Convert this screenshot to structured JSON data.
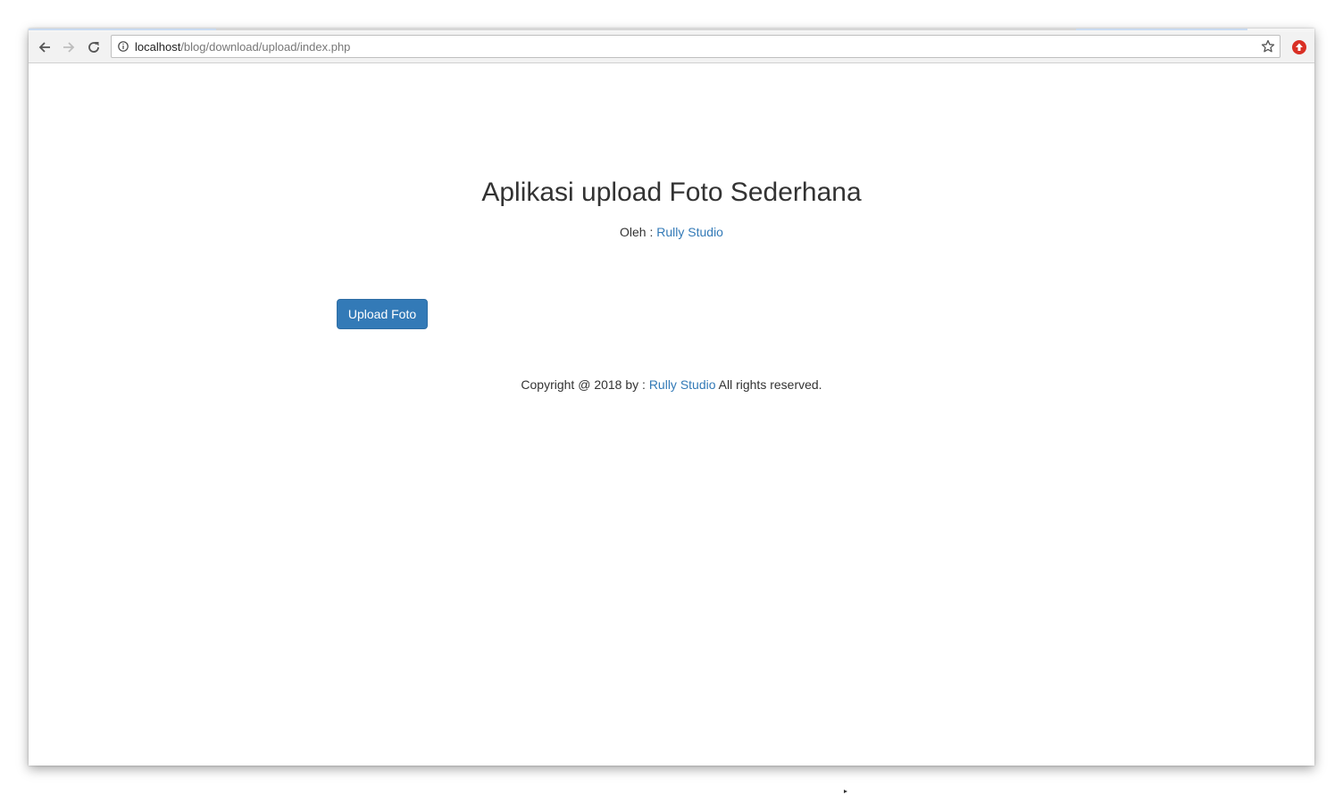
{
  "browser": {
    "url_host": "localhost",
    "url_path": "/blog/download/upload/index.php",
    "icons": {
      "back": "arrow-left-icon",
      "forward": "arrow-right-icon",
      "reload": "reload-icon",
      "info": "info-icon",
      "bookmark": "star-icon",
      "extension": "extension-icon"
    },
    "extension_color": "#d93025"
  },
  "page": {
    "title": "Aplikasi upload Foto Sederhana",
    "byline_prefix": "Oleh : ",
    "byline_link": "Rully Studio",
    "upload_button_label": "Upload Foto",
    "footer_prefix": "Copyright @ 2018 by : ",
    "footer_link": "Rully Studio",
    "footer_suffix": " All rights reserved."
  },
  "colors": {
    "primary_button": "#337ab7",
    "link": "#337ab7",
    "text": "#333333"
  }
}
